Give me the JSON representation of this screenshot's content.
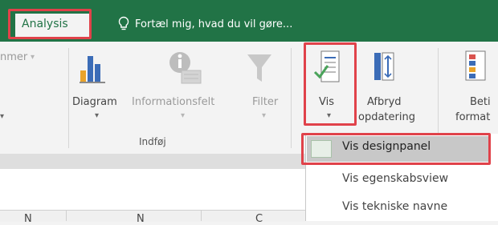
{
  "tabs": {
    "active": "Analysis"
  },
  "tell_me": {
    "text": "Fortæl mig, hvad du vil gøre..."
  },
  "ribbon": {
    "truncated_left": "nmer",
    "buttons": {
      "diagram": "Diagram",
      "informationsfelt": "Informationsfelt",
      "filter": "Filter",
      "vis": "Vis",
      "afbryd_line1": "Afbryd",
      "afbryd_line2": "opdatering",
      "beti_line1": "Beti",
      "beti_line2": "format"
    },
    "group_label": "Indføj"
  },
  "colors": {
    "brand_green": "#217346",
    "highlight_red": "#e0424a"
  },
  "dropdown": {
    "items": [
      {
        "label": "Vis designpanel",
        "checked": true,
        "selected": true
      },
      {
        "label": "Vis egenskabsview",
        "checked": false
      },
      {
        "label": "Vis tekniske navne",
        "checked": false
      }
    ]
  },
  "column_headers": [
    "N",
    "N",
    "C"
  ]
}
